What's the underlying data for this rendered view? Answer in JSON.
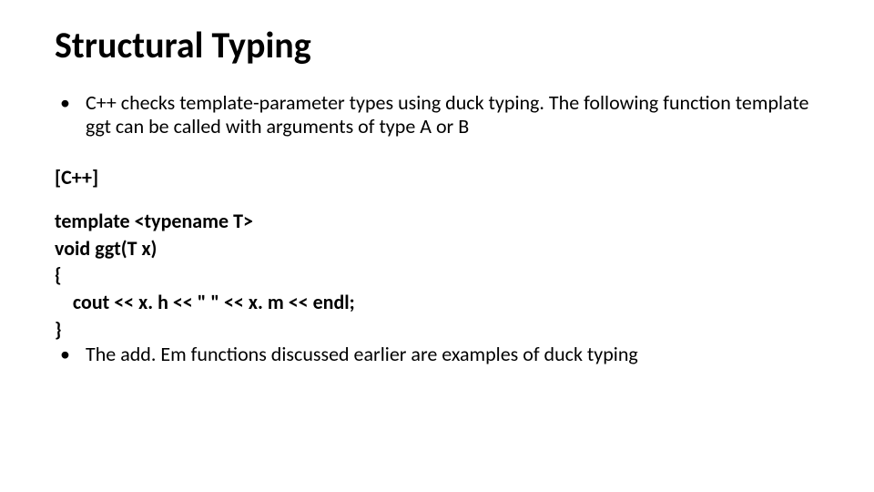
{
  "title": "Structural Typing",
  "bullets": {
    "b1": "C++ checks template-parameter types using duck typing. The following function template ggt can be called with arguments of type A or B",
    "b2": "The add. Em functions discussed earlier are examples of duck typing"
  },
  "lang_label": "[C++]",
  "code": {
    "l1": "template <typename T>",
    "l2": "void ggt(T x)",
    "l3": "{",
    "l4": "    cout << x. h << \" \" << x. m << endl;",
    "l5": "}"
  }
}
